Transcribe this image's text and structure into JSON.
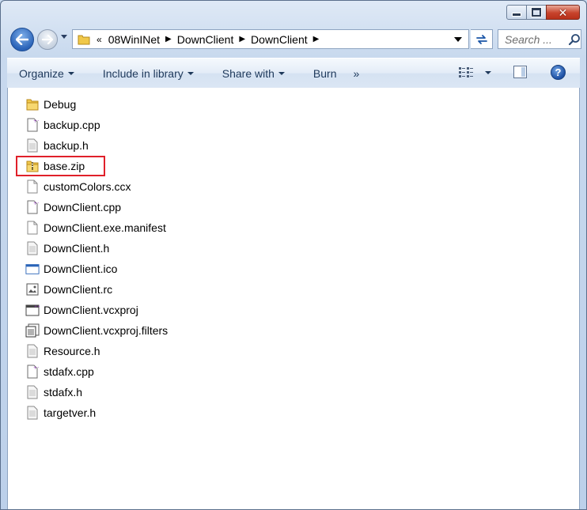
{
  "window": {
    "caption": {
      "minimize": "minimize-button",
      "maximize": "maximize-button",
      "close": "close-button"
    }
  },
  "nav": {
    "overflow_chevron": "«",
    "breadcrumbs": [
      "08WinINet",
      "DownClient",
      "DownClient"
    ],
    "search_placeholder": "Search ..."
  },
  "toolbar": {
    "organize": "Organize",
    "include_in_library": "Include in library",
    "share_with": "Share with",
    "burn": "Burn",
    "more": "»",
    "help": "?"
  },
  "files": [
    {
      "name": "Debug",
      "icon": "folder-icon"
    },
    {
      "name": "backup.cpp",
      "icon": "cpp-file-icon"
    },
    {
      "name": "backup.h",
      "icon": "text-file-icon"
    },
    {
      "name": "base.zip",
      "icon": "zip-folder-icon",
      "highlighted": true
    },
    {
      "name": "customColors.ccx",
      "icon": "blank-file-icon"
    },
    {
      "name": "DownClient.cpp",
      "icon": "cpp-file-icon"
    },
    {
      "name": "DownClient.exe.manifest",
      "icon": "blank-file-icon"
    },
    {
      "name": "DownClient.h",
      "icon": "text-file-icon"
    },
    {
      "name": "DownClient.ico",
      "icon": "ico-file-icon"
    },
    {
      "name": "DownClient.rc",
      "icon": "rc-file-icon"
    },
    {
      "name": "DownClient.vcxproj",
      "icon": "vcxproj-file-icon"
    },
    {
      "name": "DownClient.vcxproj.filters",
      "icon": "filters-file-icon"
    },
    {
      "name": "Resource.h",
      "icon": "text-file-icon"
    },
    {
      "name": "stdafx.cpp",
      "icon": "cpp-file-icon"
    },
    {
      "name": "stdafx.h",
      "icon": "text-file-icon"
    },
    {
      "name": "targetver.h",
      "icon": "text-file-icon"
    }
  ],
  "colors": {
    "highlight_border": "#e0202a",
    "command_text": "#1e395b"
  }
}
